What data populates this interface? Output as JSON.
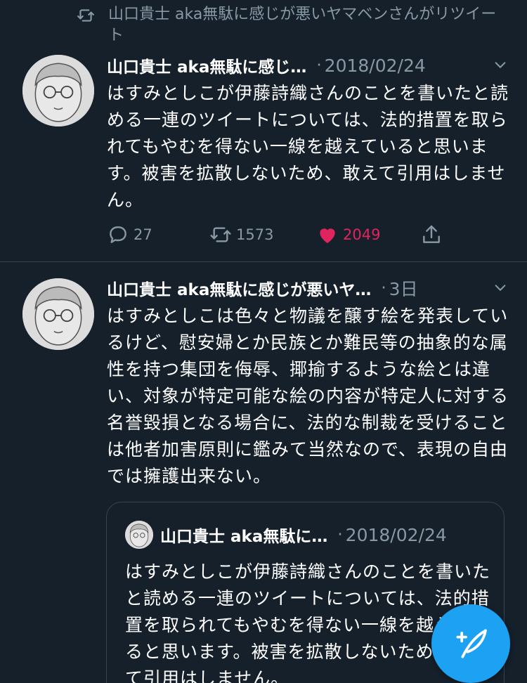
{
  "retweet_banner": {
    "icon": "retweet-icon",
    "text": "山口貴士 aka無駄に感じが悪いヤマベンさんがリツイート"
  },
  "tweets": [
    {
      "author": "山口貴士 aka無駄に感じ…",
      "date": "2018/02/24",
      "body": "はすみとしこが伊藤詩織さんのことを書いたと読める一連のツイートについては、法的措置を取られてもやむを得ない一線を越えていると思います。被害を拡散しないため、敢えて引用はしません。",
      "replies": "27",
      "retweets": "1573",
      "likes": "2049",
      "liked": true
    },
    {
      "author": "山口貴士 aka無駄に感じが悪いヤ…",
      "date": "3日",
      "body": "はすみとしこは色々と物議を醸す絵を発表しているけど、慰安婦とか民族とか難民等の抽象的な属性を持つ集団を侮辱、揶揄するような絵とは違い、対象が特定可能な絵の内容が特定人に対する名誉毀損となる場合に、法的な制裁を受けることは他者加害原則に鑑みて当然なので、表現の自由では擁護出来ない。"
    }
  ],
  "quoted_tweet": {
    "author": "山口貴士 aka無駄に…",
    "date": "2018/02/24",
    "body": "はすみとしこが伊藤詩織さんのことを書いたと読める一連のツイートについては、法的措置を取られてもやむを得ない一線を越えていると思います。被害を拡散しないため、敢えて引用はしません。"
  },
  "separator": "·",
  "colors": {
    "background": "#15202b",
    "secondary_text": "#8899a6",
    "like": "#e0245e",
    "accent": "#1da1f2",
    "divider": "#38444d"
  },
  "fab": {
    "icon": "compose-tweet-icon"
  }
}
